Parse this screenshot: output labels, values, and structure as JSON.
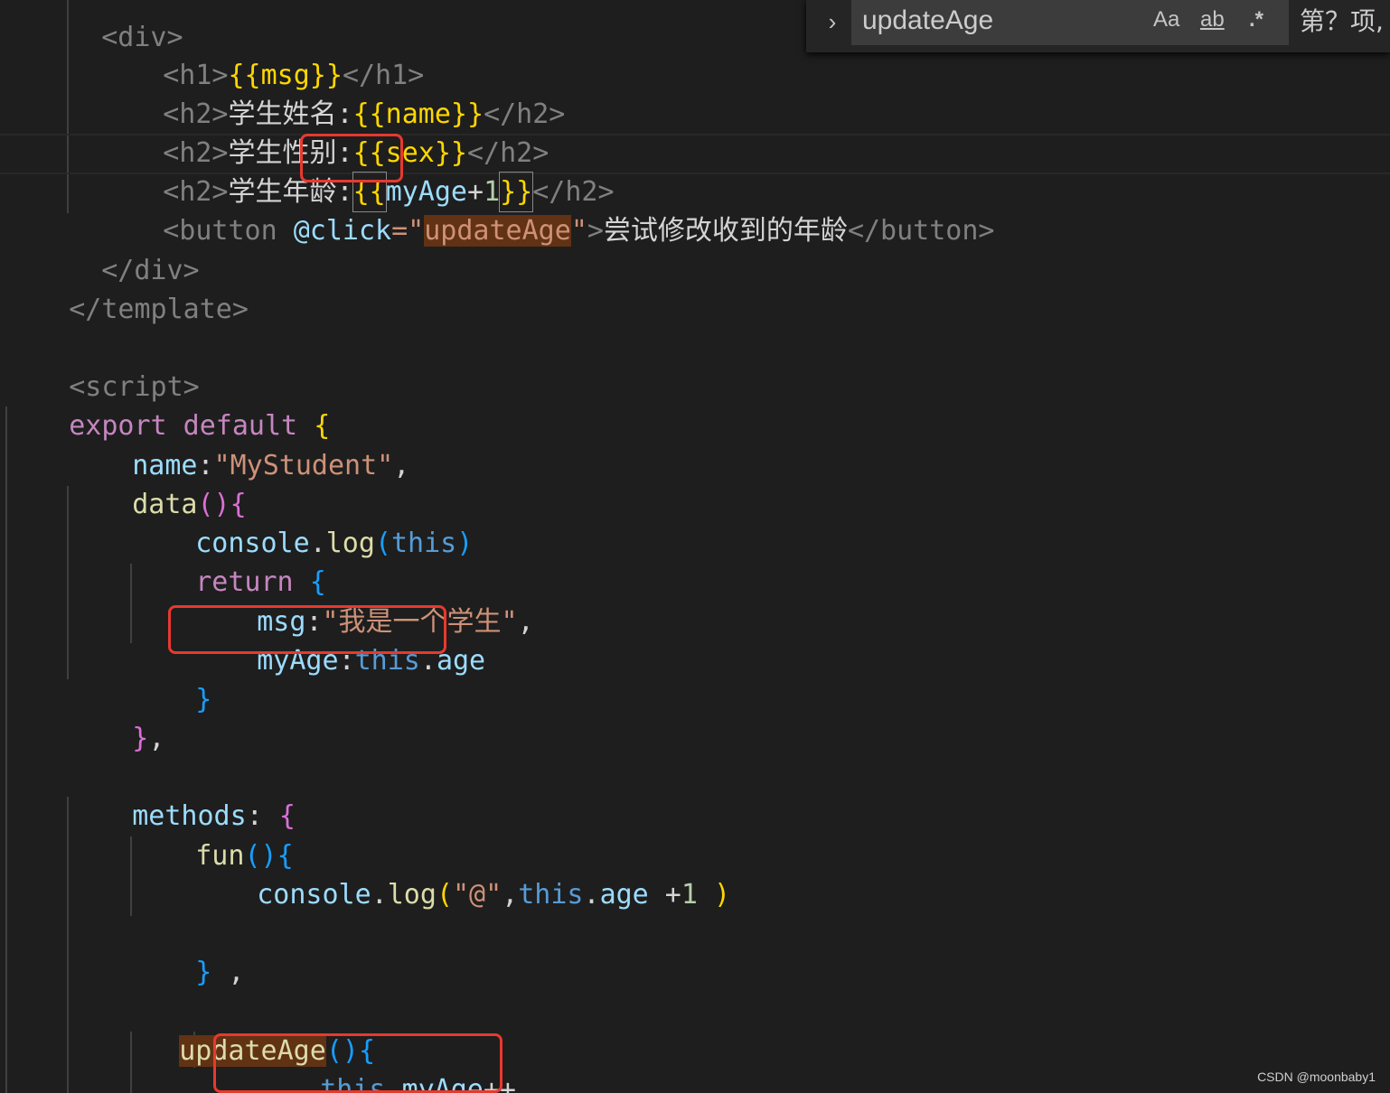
{
  "find_widget": {
    "toggle_glyph": "›",
    "query": "updateAge",
    "match_case_label": "Aa",
    "whole_word_label": "ab",
    "regex_label": ".*",
    "result_count": "第？项,"
  },
  "watermark": "CSDN @moonbaby1",
  "code": {
    "l0_tag": "<div>",
    "l1_open": "<h1>",
    "l1_expr": "{{msg}}",
    "l1_close": "</h1>",
    "l2_open": "<h2>",
    "l2_text": "学生姓名:",
    "l2_expr": "{{name}}",
    "l2_close": "</h2>",
    "l3_open": "<h2>",
    "l3_text": "学生性别:",
    "l3_expr": "{{sex}}",
    "l3_close": "</h2>",
    "l4_open": "<h2>",
    "l4_text": "学生年龄:",
    "l4_brace_open": "{{",
    "l4_var": "myAge",
    "l4_op": "+",
    "l4_num": "1",
    "l4_brace_close": "}}",
    "l4_close": "</h2>",
    "l5_tag_open": "<button",
    "l5_attr": "@click",
    "l5_eq": "=\"",
    "l5_value": "updateAge",
    "l5_quote": "\"",
    "l5_gt": ">",
    "l5_text": "尝试修改收到的年龄",
    "l5_close": "</button>",
    "l6_close": "</div>",
    "l7_close": "</template>",
    "l9_open": "<script>",
    "l10_kw": "export default",
    "l10_brace": "{",
    "l11_key": "name",
    "l11_colon": ":",
    "l11_str": "\"MyStudent\"",
    "l11_comma": ",",
    "l12_fn": "data",
    "l12_parens": "()",
    "l12_brace": "{",
    "l13_obj": "console",
    "l13_dot": ".",
    "l13_fn": "log",
    "l13_paren_open": "(",
    "l13_this": "this",
    "l13_paren_close": ")",
    "l14_kw": "return",
    "l14_brace": "{",
    "l15_key": "msg",
    "l15_colon": ":",
    "l15_str": "\"我是一个学生\"",
    "l15_comma": ",",
    "l16_key": "myAge",
    "l16_colon": ":",
    "l16_this": "this",
    "l16_dot": ".",
    "l16_prop": "age",
    "l17_brace": "}",
    "l18_brace": "}",
    "l18_comma": ",",
    "l20_key": "methods",
    "l20_colon": ":",
    "l20_brace": "{",
    "l21_fn": "fun",
    "l21_parens": "()",
    "l21_brace": "{",
    "l22_obj": "console",
    "l22_dot": ".",
    "l22_fn": "log",
    "l22_paren_open": "(",
    "l22_str": "\"@\"",
    "l22_comma": ",",
    "l22_this": "this",
    "l22_dot2": ".",
    "l22_prop": "age",
    "l22_op": " +",
    "l22_num": "1",
    "l22_paren_close": " )",
    "l24_brace": "}",
    "l24_comma": " ,",
    "l26_fn": "updateAge",
    "l26_parens": "()",
    "l26_brace": "{",
    "l27_this": "this",
    "l27_dot": ".",
    "l27_prop": "myAge",
    "l27_op": "++",
    "l28_brace": "}"
  }
}
